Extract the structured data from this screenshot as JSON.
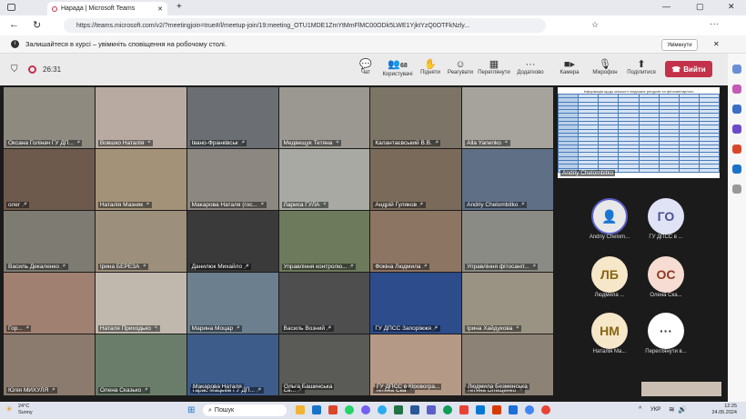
{
  "browser": {
    "tab_title": "Нарада | Microsoft Teams",
    "url": "https://teams.microsoft.com/v2/?meetingjoin=true#/l/meetup-join/19:meeting_OTU1MDE1ZmYtMmFlMC00ODk5LWE1YjktYzQ0OTFkNzly..."
  },
  "notice": {
    "text": "Залишайтеся в курсі – увімкніть сповіщення на робочому столі.",
    "button": "Увімкнути"
  },
  "toolbar": {
    "timer": "26:31",
    "chat": "Чат",
    "people": "Користувачі",
    "people_count": "68",
    "raise": "Підняти",
    "react": "Реагувати",
    "view": "Переглянути",
    "apps": "Додатково",
    "camera": "Камера",
    "mic": "Мікрофон",
    "share": "Поділитися",
    "leave": "Вийти"
  },
  "tiles": [
    {
      "name": "Оксана Голінач ГУ ДП..."
    },
    {
      "name": "Вовшко Наталія"
    },
    {
      "name": "Івано-Франківськ"
    },
    {
      "name": "Медвещук Тетяна"
    },
    {
      "name": "Калантаєвський В.В."
    },
    {
      "name": "Alla Yanenko"
    },
    {
      "name": "олег"
    },
    {
      "name": "Наталія Мазняк"
    },
    {
      "name": "Макарова Наталя (гос..."
    },
    {
      "name": "Лариса ГУЛА"
    },
    {
      "name": "Андрій Гуляков"
    },
    {
      "name": "Andriy Chelombitko"
    },
    {
      "name": "Василь Декаленко"
    },
    {
      "name": "Ірина БЕРЕЗА"
    },
    {
      "name": "Данилюк Михайло"
    },
    {
      "name": "Управління контролю..."
    },
    {
      "name": "Фокіна Людмила"
    },
    {
      "name": "Управління фітосаніт..."
    },
    {
      "name": "Гор..."
    },
    {
      "name": "Наталя Приходько"
    },
    {
      "name": "Марина Моцар"
    },
    {
      "name": "Василь Возний"
    },
    {
      "name": "ГУ ДПСС Запоріжжя"
    },
    {
      "name": "Ірина Хайдукова"
    },
    {
      "name": "Юлія МИХУЛЯ"
    },
    {
      "name": "Олена Сказько"
    },
    {
      "name": "Тарас Мацьків ГУ ДП..."
    },
    {
      "name": "Єв..."
    },
    {
      "name": "Тетяна Єва"
    },
    {
      "name": "Тетяна Олещенко"
    }
  ],
  "tiles_row5": [
    {
      "name": "Макарова Наталя"
    },
    {
      "name": "Ольга Башинська"
    },
    {
      "name": "ГУ ДПСС в Кіровогра..."
    },
    {
      "name": "Людмила Безменська"
    }
  ],
  "share": {
    "name": "Andriy Chelombitko",
    "title": "Інформація щодо кількості людських ресурсів та фітосанітарного"
  },
  "participants": [
    {
      "initials": "",
      "name": "Andriy Chelom..."
    },
    {
      "initials": "ГО",
      "name": "ГУ ДПСС в ..."
    },
    {
      "initials": "ЛБ",
      "name": "Людмила ..."
    },
    {
      "initials": "ОС",
      "name": "Олена Ска..."
    },
    {
      "initials": "НМ",
      "name": "Наталія Ма..."
    },
    {
      "initials": "···",
      "name": "Переглянути в..."
    }
  ],
  "taskbar": {
    "weather_temp": "24°C",
    "weather": "Sunny",
    "search": "Пошук",
    "lang": "УКР",
    "time": "12:25",
    "date": "24.05.2024"
  },
  "colors": {
    "accent": "#5b5fc7",
    "leave": "#c4314b"
  }
}
